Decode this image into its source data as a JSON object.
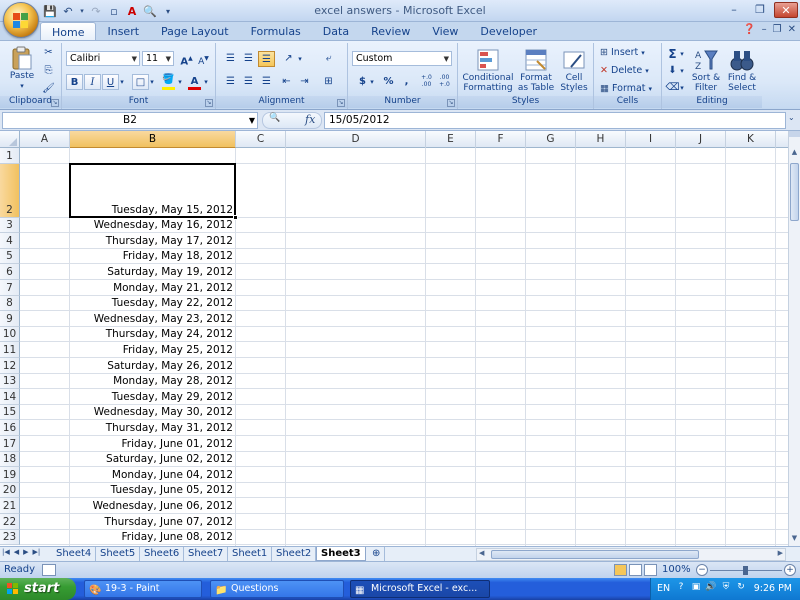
{
  "window": {
    "title": "excel answers - Microsoft Excel"
  },
  "tabs": [
    "Home",
    "Insert",
    "Page Layout",
    "Formulas",
    "Data",
    "Review",
    "View",
    "Developer"
  ],
  "active_tab": "Home",
  "ribbon": {
    "clipboard": {
      "label": "Clipboard",
      "paste": "Paste"
    },
    "font": {
      "label": "Font",
      "font_name": "Calibri",
      "font_size": "11",
      "bold": "B",
      "italic": "I",
      "underline": "U",
      "font_color": "A"
    },
    "alignment": {
      "label": "Alignment"
    },
    "number": {
      "label": "Number",
      "format": "Custom",
      "currency": "$",
      "percent": "%",
      "comma": ",",
      "inc_decimal": "+.0 .00",
      "dec_decimal": ".00 +.0"
    },
    "styles": {
      "label": "Styles",
      "conditional_formatting": "Conditional Formatting",
      "format_as_table": "Format as Table",
      "cell_styles": "Cell Styles"
    },
    "cells": {
      "label": "Cells",
      "insert": "Insert",
      "delete": "Delete",
      "format": "Format"
    },
    "editing": {
      "label": "Editing",
      "sort_filter": "Sort & Filter",
      "find_select": "Find & Select",
      "sigma": "Σ"
    }
  },
  "formula_bar": {
    "name_box": "B2",
    "fx": "fx",
    "formula": "15/05/2012"
  },
  "columns": [
    "A",
    "B",
    "C",
    "D",
    "E",
    "F",
    "G",
    "H",
    "I",
    "J",
    "K"
  ],
  "selected_column": "B",
  "selected_row": "2",
  "rows": [
    {
      "num": "1",
      "b": ""
    },
    {
      "num": "2",
      "b": "Tuesday, May 15, 2012"
    },
    {
      "num": "3",
      "b": "Wednesday, May 16, 2012"
    },
    {
      "num": "4",
      "b": "Thursday, May 17, 2012"
    },
    {
      "num": "5",
      "b": "Friday, May 18, 2012"
    },
    {
      "num": "6",
      "b": "Saturday, May 19, 2012"
    },
    {
      "num": "7",
      "b": "Monday, May 21, 2012"
    },
    {
      "num": "8",
      "b": "Tuesday, May 22, 2012"
    },
    {
      "num": "9",
      "b": "Wednesday, May 23, 2012"
    },
    {
      "num": "10",
      "b": "Thursday, May 24, 2012"
    },
    {
      "num": "11",
      "b": "Friday, May 25, 2012"
    },
    {
      "num": "12",
      "b": "Saturday, May 26, 2012"
    },
    {
      "num": "13",
      "b": "Monday, May 28, 2012"
    },
    {
      "num": "14",
      "b": "Tuesday, May 29, 2012"
    },
    {
      "num": "15",
      "b": "Wednesday, May 30, 2012"
    },
    {
      "num": "16",
      "b": "Thursday, May 31, 2012"
    },
    {
      "num": "17",
      "b": "Friday, June 01, 2012"
    },
    {
      "num": "18",
      "b": "Saturday, June 02, 2012"
    },
    {
      "num": "19",
      "b": "Monday, June 04, 2012"
    },
    {
      "num": "20",
      "b": "Tuesday, June 05, 2012"
    },
    {
      "num": "21",
      "b": "Wednesday, June 06, 2012"
    },
    {
      "num": "22",
      "b": "Thursday, June 07, 2012"
    },
    {
      "num": "23",
      "b": "Friday, June 08, 2012"
    }
  ],
  "sheets": [
    "Sheet4",
    "Sheet5",
    "Sheet6",
    "Sheet7",
    "Sheet1",
    "Sheet2",
    "Sheet3"
  ],
  "active_sheet": "Sheet3",
  "status": {
    "ready": "Ready",
    "zoom": "100%"
  },
  "taskbar": {
    "start": "start",
    "tasks": [
      "19-3 - Paint",
      "Questions",
      "Microsoft Excel - exc..."
    ],
    "active_task": "Microsoft Excel - exc...",
    "lang": "EN",
    "time": "9:26 PM"
  }
}
